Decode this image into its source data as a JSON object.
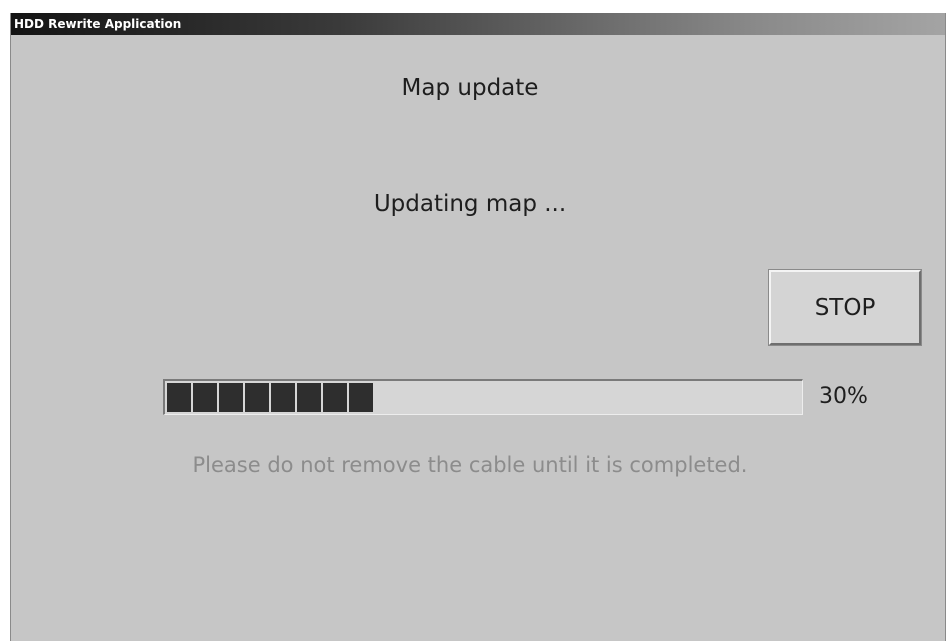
{
  "window": {
    "title": "HDD Rewrite Application"
  },
  "main": {
    "heading": "Map update",
    "status": "Updating map ...",
    "stop_label": "STOP",
    "progress": {
      "value": 0.3,
      "label": "30%",
      "total_segments": 25
    },
    "notice": "Please do not remove the cable until it is completed."
  },
  "colors": {
    "background": "#c6c6c6",
    "progress_fill": "#2e2e2e",
    "notice_text": "#8c8c8c"
  }
}
